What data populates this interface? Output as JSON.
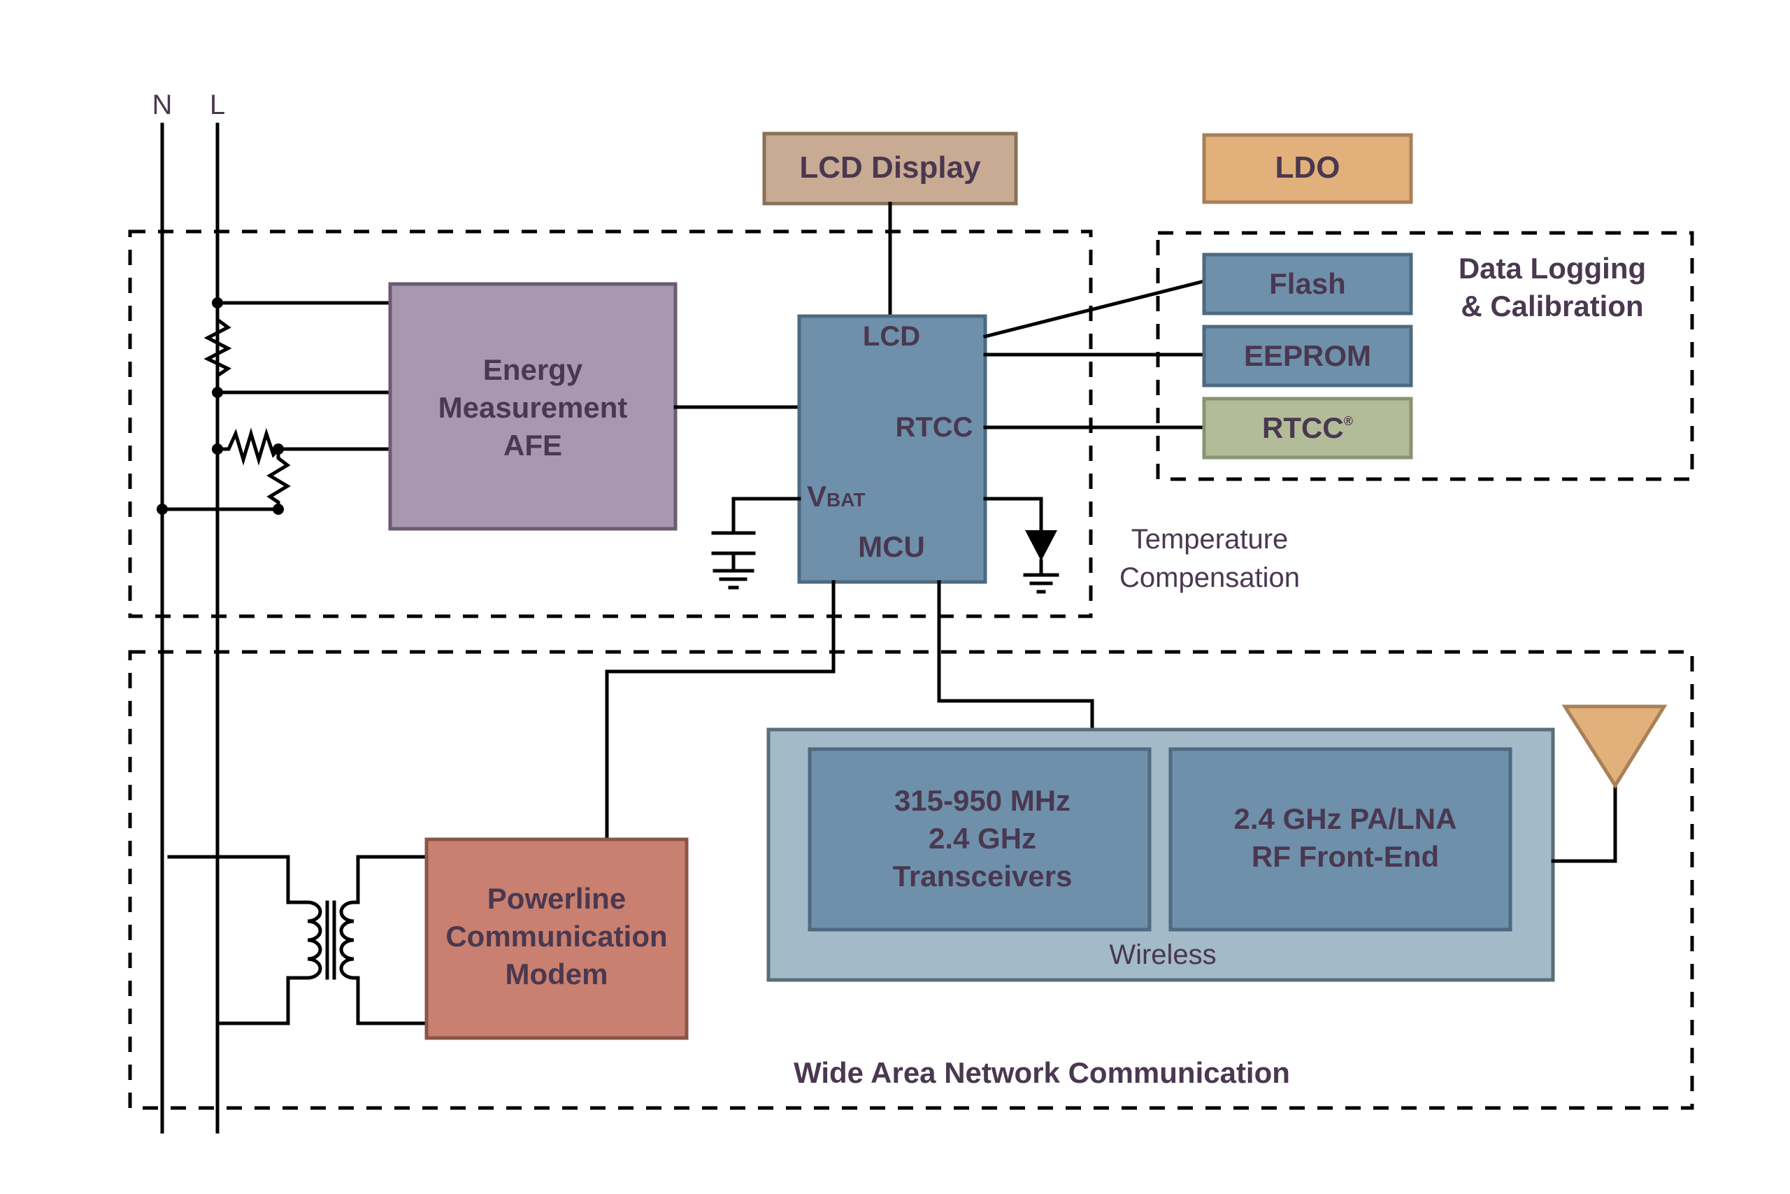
{
  "rails": {
    "neutral": "N",
    "line": "L"
  },
  "blocks": {
    "lcd_display": {
      "label": "LCD Display",
      "fill": "#c9ab94",
      "stroke": "#8a7058"
    },
    "ldo": {
      "label": "LDO",
      "fill": "#e2b07a",
      "stroke": "#a88058"
    },
    "energy_afe": {
      "lines": [
        "Energy",
        "Measurement",
        "AFE"
      ],
      "fill": "#a897b0",
      "stroke": "#6a5a72"
    },
    "mcu": {
      "label": "MCU",
      "pin_lcd": "LCD",
      "pin_rtcc": "RTCC",
      "pin_vbat_main": "V",
      "pin_vbat_sub": "BAT",
      "fill": "#6e90ab",
      "stroke": "#4e6a80"
    },
    "flash": {
      "label": "Flash",
      "fill": "#6e90ab",
      "stroke": "#4e6a80"
    },
    "eeprom": {
      "label": "EEPROM",
      "fill": "#6e90ab",
      "stroke": "#4e6a80"
    },
    "rtcc": {
      "label": "RTCC",
      "mark": "®",
      "fill": "#b3bc98",
      "stroke": "#8a9274"
    },
    "powerline_modem": {
      "lines": [
        "Powerline",
        "Communication",
        "Modem"
      ],
      "fill": "#c98070",
      "stroke": "#8a5448"
    },
    "wireless": {
      "label": "Wireless",
      "fill": "#a3bac8",
      "stroke": "#5a6e78",
      "transceivers": {
        "lines": [
          "315-950 MHz",
          "2.4 GHz",
          "Transceivers"
        ]
      },
      "rf_front_end": {
        "lines": [
          "2.4 GHz PA/LNA",
          "RF Front-End"
        ]
      },
      "inner_fill": "#6e90ab",
      "inner_stroke": "#4e6a80"
    },
    "antenna": {
      "fill": "#e2b07a",
      "stroke": "#a88058"
    }
  },
  "groups": {
    "data_logging": {
      "lines": [
        "Data Logging",
        "& Calibration"
      ]
    },
    "temperature": {
      "lines": [
        "Temperature",
        "Compensation"
      ]
    },
    "wan": {
      "label": "Wide Area Network Communication"
    }
  },
  "icons": {
    "resistor": "resistor-icon",
    "capacitor": "capacitor-icon",
    "diode": "diode-icon",
    "ground": "ground-icon",
    "transformer": "transformer-icon",
    "antenna": "antenna-icon"
  },
  "colors": {
    "text": "#4a3850",
    "wire": "#000000"
  }
}
